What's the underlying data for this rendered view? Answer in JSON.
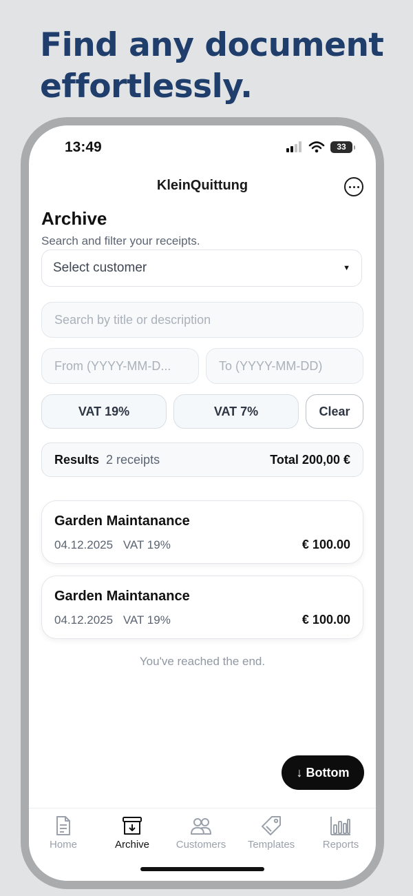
{
  "headline": "Find any document effortlessly.",
  "status": {
    "time": "13:49",
    "battery": "33"
  },
  "header": {
    "title": "KleinQuittung"
  },
  "page": {
    "title": "Archive",
    "subtitle": "Search and filter your receipts."
  },
  "filters": {
    "customer_select": "Select customer",
    "search_placeholder": "Search by title or description",
    "from_placeholder": "From (YYYY-MM-D...",
    "to_placeholder": "To (YYYY-MM-DD)",
    "vat19_label": "VAT 19%",
    "vat7_label": "VAT 7%",
    "clear_label": "Clear"
  },
  "results": {
    "label": "Results",
    "count": "2 receipts",
    "total": "Total 200,00 €"
  },
  "receipts": [
    {
      "title": "Garden Maintanance",
      "date": "04.12.2025",
      "vat": "VAT 19%",
      "amount": "€ 100.00"
    },
    {
      "title": "Garden Maintanance",
      "date": "04.12.2025",
      "vat": "VAT 19%",
      "amount": "€ 100.00"
    }
  ],
  "end_note": "You've reached the end.",
  "scroll_bottom_label": "↓ Bottom",
  "tabs": [
    {
      "label": "Home",
      "icon": "document-icon",
      "active": false
    },
    {
      "label": "Archive",
      "icon": "archive-box-icon",
      "active": true
    },
    {
      "label": "Customers",
      "icon": "people-icon",
      "active": false
    },
    {
      "label": "Templates",
      "icon": "tag-icon",
      "active": false
    },
    {
      "label": "Reports",
      "icon": "bar-chart-icon",
      "active": false
    }
  ],
  "colors": {
    "headline": "#1f3e6b",
    "background": "#e2e3e5",
    "accent": "#0d0d0d"
  }
}
